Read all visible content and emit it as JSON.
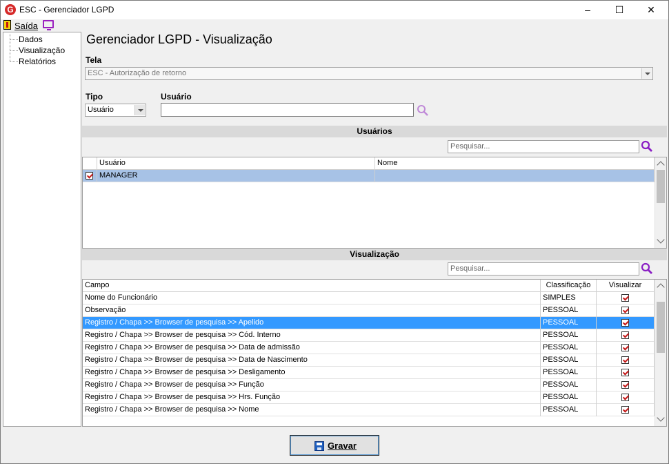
{
  "window": {
    "title": "ESC - Gerenciador LGPD",
    "app_icon_letter": "G",
    "min_glyph": "–",
    "max_glyph": "☐",
    "close_glyph": "✕"
  },
  "menu": {
    "exit_label": "Saída",
    "exit_icon": "exit-door-icon",
    "monitor_icon": "monitor-icon"
  },
  "tree": {
    "items": [
      {
        "label": "Dados"
      },
      {
        "label": "Visualização"
      },
      {
        "label": "Relatórios"
      }
    ]
  },
  "main": {
    "title": "Gerenciador LGPD - Visualização",
    "tela_label": "Tela",
    "tela_value": "ESC - Autorização de retorno",
    "tipo_label": "Tipo",
    "tipo_value": "Usuário",
    "usuario_label": "Usuário",
    "usuario_value": ""
  },
  "users_section": {
    "title": "Usuários",
    "search_placeholder": "Pesquisar...",
    "columns": [
      "Usuário",
      "Nome"
    ],
    "rows": [
      {
        "checked": true,
        "usuario": "MANAGER",
        "nome": ""
      }
    ]
  },
  "view_section": {
    "title": "Visualização",
    "search_placeholder": "Pesquisar...",
    "columns": [
      "Campo",
      "Classificação",
      "Visualizar"
    ],
    "rows": [
      {
        "campo": "Nome do Funcionário",
        "classificacao": "SIMPLES",
        "visualizar": true
      },
      {
        "campo": "Observação",
        "classificacao": "PESSOAL",
        "visualizar": true
      },
      {
        "campo": "Registro / Chapa >> Browser de pesquisa >> Apelido",
        "classificacao": "PESSOAL",
        "visualizar": true,
        "selected": true
      },
      {
        "campo": "Registro / Chapa >> Browser de pesquisa >> Cód. Interno",
        "classificacao": "PESSOAL",
        "visualizar": true
      },
      {
        "campo": "Registro / Chapa >> Browser de pesquisa >> Data de admissão",
        "classificacao": "PESSOAL",
        "visualizar": true
      },
      {
        "campo": "Registro / Chapa >> Browser de pesquisa >> Data de Nascimento",
        "classificacao": "PESSOAL",
        "visualizar": true
      },
      {
        "campo": "Registro / Chapa >> Browser de pesquisa >> Desligamento",
        "classificacao": "PESSOAL",
        "visualizar": true
      },
      {
        "campo": "Registro / Chapa >> Browser de pesquisa >> Função",
        "classificacao": "PESSOAL",
        "visualizar": true
      },
      {
        "campo": "Registro / Chapa >> Browser de pesquisa >> Hrs. Função",
        "classificacao": "PESSOAL",
        "visualizar": true
      },
      {
        "campo": "Registro / Chapa >> Browser de pesquisa >> Nome",
        "classificacao": "PESSOAL",
        "visualizar": true
      }
    ]
  },
  "footer": {
    "save_label": "Gravar",
    "save_icon": "floppy-disk-icon"
  },
  "colors": {
    "selected_row": "#3399ff",
    "user_row_highlight": "#a7c2e6",
    "accent_purple": "#9b1fbf",
    "check_red": "#c41818"
  }
}
